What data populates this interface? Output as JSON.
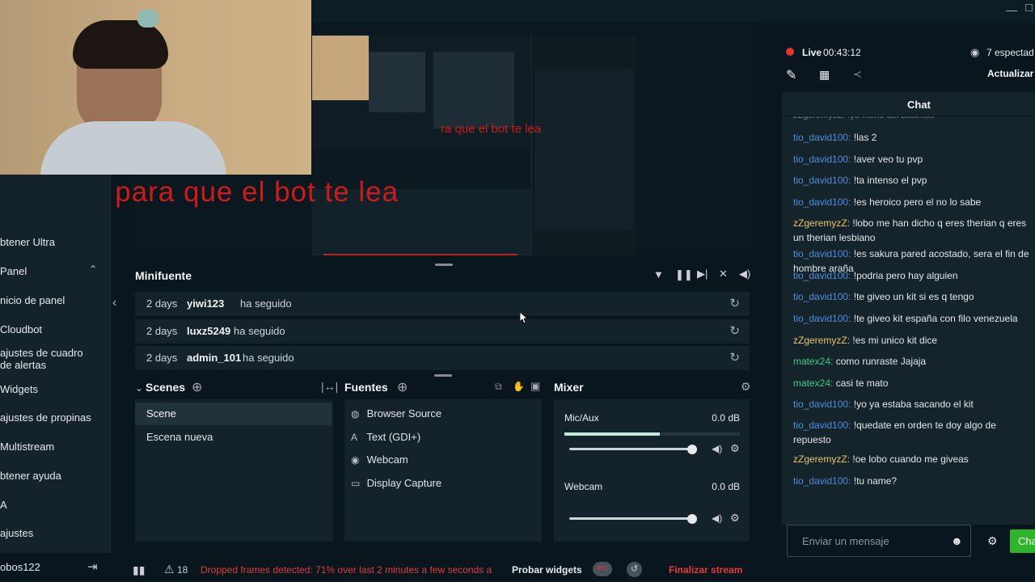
{
  "stream": {
    "live_label": "Live",
    "timer": "00:43:12",
    "viewers": "7 espectad",
    "update_label": "Actualizar"
  },
  "overlay": {
    "big_text": "usa ´´!´´ para que el bot te lea",
    "small_text": "ra que el bot te lea"
  },
  "sidebar": {
    "items": [
      {
        "label": "btener Ultra"
      },
      {
        "label": "Panel"
      },
      {
        "label": "nicio de panel"
      },
      {
        "label": "Cloudbot"
      },
      {
        "label": "ajustes de cuadro de alertas"
      },
      {
        "label": "Widgets"
      },
      {
        "label": "ajustes de propinas"
      },
      {
        "label": "Multistream"
      },
      {
        "label": "btener ayuda"
      },
      {
        "label": "A"
      },
      {
        "label": "ajustes"
      }
    ],
    "user": "obos122"
  },
  "minifuente": {
    "title": "Minifuente",
    "events": [
      {
        "time": "2 days",
        "user": "yiwi123",
        "action": "ha seguido"
      },
      {
        "time": "2 days",
        "user": "luxz5249",
        "action": "ha seguido"
      },
      {
        "time": "2 days",
        "user": "admin_101",
        "action": "ha seguido"
      }
    ]
  },
  "scenes": {
    "title": "Scenes",
    "items": [
      "Scene",
      "Escena nueva"
    ]
  },
  "sources": {
    "title": "Fuentes",
    "items": [
      {
        "icon": "globe-icon",
        "label": "Browser Source"
      },
      {
        "icon": "text-icon",
        "label": "Text (GDI+)"
      },
      {
        "icon": "webcam-icon",
        "label": "Webcam"
      },
      {
        "icon": "monitor-icon",
        "label": "Display Capture"
      }
    ]
  },
  "mixer": {
    "title": "Mixer",
    "channels": [
      {
        "name": "Mic/Aux",
        "level": "0.0 dB"
      },
      {
        "name": "Webcam",
        "level": "0.0 dB"
      }
    ]
  },
  "bottom": {
    "alert_count": "18",
    "warning": "Dropped frames detected: 71% over last 2 minutes a few seconds a",
    "test_widgets": "Probar widgets",
    "rec": "REC",
    "end_stream": "Finalizar stream"
  },
  "chat": {
    "title": "Chat",
    "partial_top": "zZgeremyzZ: !yo meno del costmos",
    "messages": [
      {
        "user": "tio_david100",
        "color": "blue",
        "text": "!las 2"
      },
      {
        "user": "tio_david100",
        "color": "blue",
        "text": "!aver veo tu pvp"
      },
      {
        "user": "tio_david100",
        "color": "blue",
        "text": "!ta intenso el pvp"
      },
      {
        "user": "tio_david100",
        "color": "blue",
        "text": "!es heroico pero el no lo sabe"
      },
      {
        "user": "zZgeremyzZ",
        "color": "yellow",
        "text": "!lobo me han dicho q eres therian q eres un therian lesbiano"
      },
      {
        "user": "tio_david100",
        "color": "blue",
        "text": "!es sakura pared acostado, sera el fin de hombre araña"
      },
      {
        "user": "tio_david100",
        "color": "blue",
        "text": "!podria pero hay alguien"
      },
      {
        "user": "tio_david100",
        "color": "blue",
        "text": "!te giveo un kit si es q tengo"
      },
      {
        "user": "tio_david100",
        "color": "blue",
        "text": "!te giveo kit españa con filo venezuela"
      },
      {
        "user": "zZgeremyzZ",
        "color": "yellow",
        "text": "!es mi unico kit dice"
      },
      {
        "user": "matex24",
        "color": "green",
        "text": "como runraste Jajaja"
      },
      {
        "user": "matex24",
        "color": "green",
        "text": "casi te mato"
      },
      {
        "user": "tio_david100",
        "color": "blue",
        "text": "!yo ya estaba sacando el kit"
      },
      {
        "user": "tio_david100",
        "color": "blue",
        "text": "!quedate en orden te doy algo de repuesto"
      },
      {
        "user": "zZgeremyzZ",
        "color": "yellow",
        "text": "!oe lobo cuando me giveas"
      },
      {
        "user": "tio_david100",
        "color": "blue",
        "text": "!tu name?"
      }
    ],
    "input_placeholder": "Enviar un mensaje",
    "send_label": "Cha"
  }
}
